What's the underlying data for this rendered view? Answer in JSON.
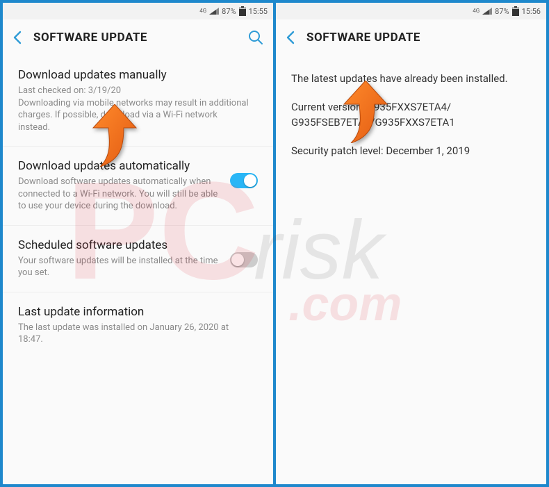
{
  "statusbar": {
    "net": "4G",
    "battery_pct": "87%",
    "time_left": "15:55",
    "time_right": "15:56"
  },
  "appbar": {
    "title": "SOFTWARE UPDATE"
  },
  "left": {
    "manual": {
      "title": "Download updates manually",
      "line1": "Last checked on: 3/19/20",
      "line2": "Downloading via mobile networks may result in additional charges. If possible, download via a Wi-Fi network instead."
    },
    "auto": {
      "title": "Download updates automatically",
      "desc": "Download software updates automatically when connected to a Wi-Fi network. You will still be able to use your device during the download."
    },
    "scheduled": {
      "title": "Scheduled software updates",
      "desc": "Your software updates will be installed at the time you set."
    },
    "lastinfo": {
      "title": "Last update information",
      "desc": "The last update was installed on January 26, 2020 at 18:47."
    }
  },
  "right": {
    "message": "The latest updates have already been installed.",
    "version_label": "Current version:",
    "version_line1": "G935FXXS7ETA4/",
    "version_line2": "G935FSEB7ETA1/G935FXXS7ETA1",
    "security": "Security patch level: December 1, 2019"
  },
  "watermark": {
    "main": "PC",
    "sub": "risk",
    "domain": ".com"
  }
}
